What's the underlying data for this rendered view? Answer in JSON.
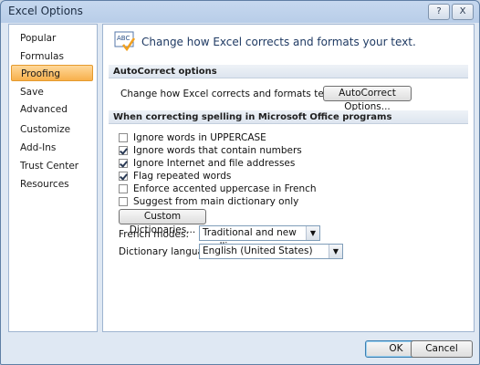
{
  "window": {
    "title": "Excel Options"
  },
  "titlebar_buttons": {
    "help": "?",
    "close": "X"
  },
  "nav": {
    "items": [
      {
        "label": "Popular"
      },
      {
        "label": "Formulas"
      },
      {
        "label": "Proofing",
        "selected": true
      },
      {
        "label": "Save"
      },
      {
        "label": "Advanced"
      },
      {
        "label": "Customize"
      },
      {
        "label": "Add-Ins"
      },
      {
        "label": "Trust Center"
      },
      {
        "label": "Resources"
      }
    ]
  },
  "header": {
    "text": "Change how Excel corrects and formats your text.",
    "icon": "abc-check-icon",
    "icon_text": "ABC"
  },
  "autocorrect": {
    "section_title": "AutoCorrect options",
    "label": "Change how Excel corrects and formats text as you type:",
    "button": "AutoCorrect Options..."
  },
  "spelling": {
    "section_title": "When correcting spelling in Microsoft Office programs",
    "options": [
      {
        "label": "Ignore words in UPPERCASE",
        "checked": false
      },
      {
        "label": "Ignore words that contain numbers",
        "checked": true
      },
      {
        "label": "Ignore Internet and file addresses",
        "checked": true
      },
      {
        "label": "Flag repeated words",
        "checked": true
      },
      {
        "label": "Enforce accented uppercase in French",
        "checked": false
      },
      {
        "label": "Suggest from main dictionary only",
        "checked": false
      }
    ],
    "custom_dictionaries_button": "Custom Dictionaries...",
    "french_modes_label": "French modes:",
    "french_modes_value": "Traditional and new spellings",
    "dictionary_language_label": "Dictionary language:",
    "dictionary_language_value": "English (United States)"
  },
  "footer": {
    "ok": "OK",
    "cancel": "Cancel"
  },
  "colors": {
    "selected_nav": "#f7b04c",
    "header_text": "#1f3a63",
    "window_bg": "#dfe8f3"
  }
}
